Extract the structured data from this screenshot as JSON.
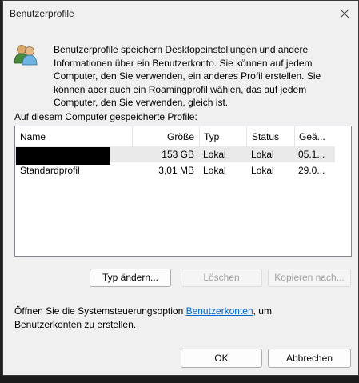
{
  "window": {
    "title": "Benutzerprofile",
    "description": "Benutzerprofile speichern Desktopeinstellungen und andere Informationen über ein Benutzerkonto. Sie können auf jedem Computer, den Sie verwenden, ein anderes Profil erstellen. Sie können aber auch ein Roamingprofil wählen, das auf jedem Computer, den Sie verwenden, gleich ist.",
    "icons": {
      "user": "users-icon",
      "close": "close-icon"
    }
  },
  "profiles": {
    "caption": "Auf diesem Computer gespeicherte Profile:",
    "columns": {
      "name": "Name",
      "size": "Größe",
      "type": "Typ",
      "status": "Status",
      "date": "Geä..."
    },
    "rows": [
      {
        "name": "",
        "size": "153 GB",
        "type": "Lokal",
        "status": "Lokal",
        "date": "05.1...",
        "selected": true
      },
      {
        "name": "Standardprofil",
        "size": "3,01 MB",
        "type": "Lokal",
        "status": "Lokal",
        "date": "29.0...",
        "selected": false
      }
    ]
  },
  "actions": {
    "change_type": "Typ ändern...",
    "delete": "Löschen",
    "copy_to": "Kopieren nach..."
  },
  "hint": {
    "prefix": "Öffnen Sie die Systemsteuerungsoption ",
    "link": "Benutzerkonten",
    "suffix": ", um Benutzerkonten zu erstellen."
  },
  "footer": {
    "ok": "OK",
    "cancel": "Abbrechen"
  }
}
